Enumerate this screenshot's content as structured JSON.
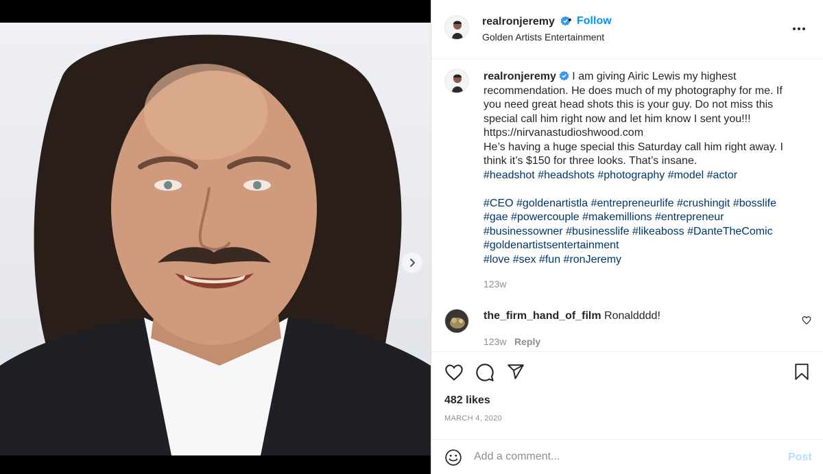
{
  "post": {
    "username": "realronjeremy",
    "follow_label": "Follow",
    "separator": "•",
    "subtitle": "Golden Artists Entertainment"
  },
  "caption": {
    "lines": [
      "I am giving Airic Lewis my highest",
      "recommendation. He does much of my photography for me. If",
      "you need great head shots this is your guy. Do not miss this",
      "special call him right now and let him know I sent you!!!",
      "https://nirvanastudioshwood.com",
      "He’s having a huge special this Saturday call him right away. I",
      "think it’s $150 for three looks. That’s insane."
    ],
    "hashtags_1": [
      "#headshot",
      "#headshots",
      "#photography",
      "#model",
      "#actor"
    ],
    "hashtags_2": [
      [
        "#CEO",
        "#goldenartistla",
        "#entrepreneurlife",
        "#crushingit",
        "#bosslife"
      ],
      [
        "#gae",
        "#powercouple",
        "#makemillions",
        "#entrepreneur"
      ],
      [
        "#businessowner",
        "#businesslife",
        "#likeaboss",
        "#DanteTheComic"
      ],
      [
        "#goldenartistsentertainment"
      ],
      [
        "#love",
        "#sex",
        "#fun",
        "#ronJeremy"
      ]
    ],
    "time": "123w"
  },
  "comment": {
    "username": "the_firm_hand_of_film",
    "text": "Ronaldddd!",
    "time": "123w",
    "reply_label": "Reply"
  },
  "stats": {
    "likes": "482 likes",
    "date": "MARCH 4, 2020"
  },
  "composer": {
    "placeholder": "Add a comment...",
    "post_label": "Post"
  },
  "carousel": {
    "dot_count": 4,
    "active_index": 0
  },
  "colors": {
    "link_blue": "#0095f6",
    "hashtag": "#00376b",
    "muted": "#8e8e8e",
    "post_disabled": "#b2dffc"
  },
  "icons": [
    "verified-badge-icon",
    "more-options-icon",
    "heart-icon",
    "comment-icon",
    "share-icon",
    "bookmark-icon",
    "emoji-icon",
    "chevron-right-icon"
  ]
}
